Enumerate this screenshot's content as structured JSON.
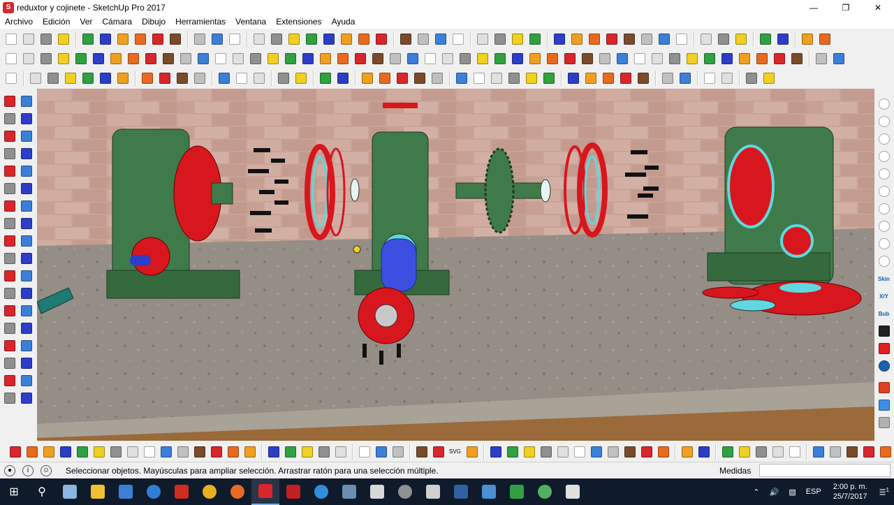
{
  "window": {
    "title": "reduxtor y cojinete - SketchUp Pro 2017",
    "app_icon": "sketchup-logo-icon",
    "controls": [
      "minimize-icon",
      "maximize-icon",
      "close-icon"
    ]
  },
  "menu": [
    "Archivo",
    "Edición",
    "Ver",
    "Cámara",
    "Dibujo",
    "Herramientas",
    "Ventana",
    "Extensiones",
    "Ayuda"
  ],
  "right_tool_labels": {
    "skin": "Skin",
    "xy": "X/Y",
    "bub": "Bub"
  },
  "bottom_tool_labels": {
    "svg": "SVG"
  },
  "status": {
    "message": "Seleccionar objetos. Mayúsculas para ampliar selección. Arrastrar ratón para una selección múltiple.",
    "measures_label": "Medidas",
    "measures_value": ""
  },
  "taskbar": {
    "language": "ESP",
    "time": "2:00 p. m.",
    "date": "25/7/2017",
    "notification_count": "1"
  },
  "colors": {
    "machine_green": "#3f7a4a",
    "flange_red": "#d8161e",
    "gasket_cyan": "#5fd8e0",
    "wall": "#c9a79a",
    "table": "#9a9288"
  }
}
